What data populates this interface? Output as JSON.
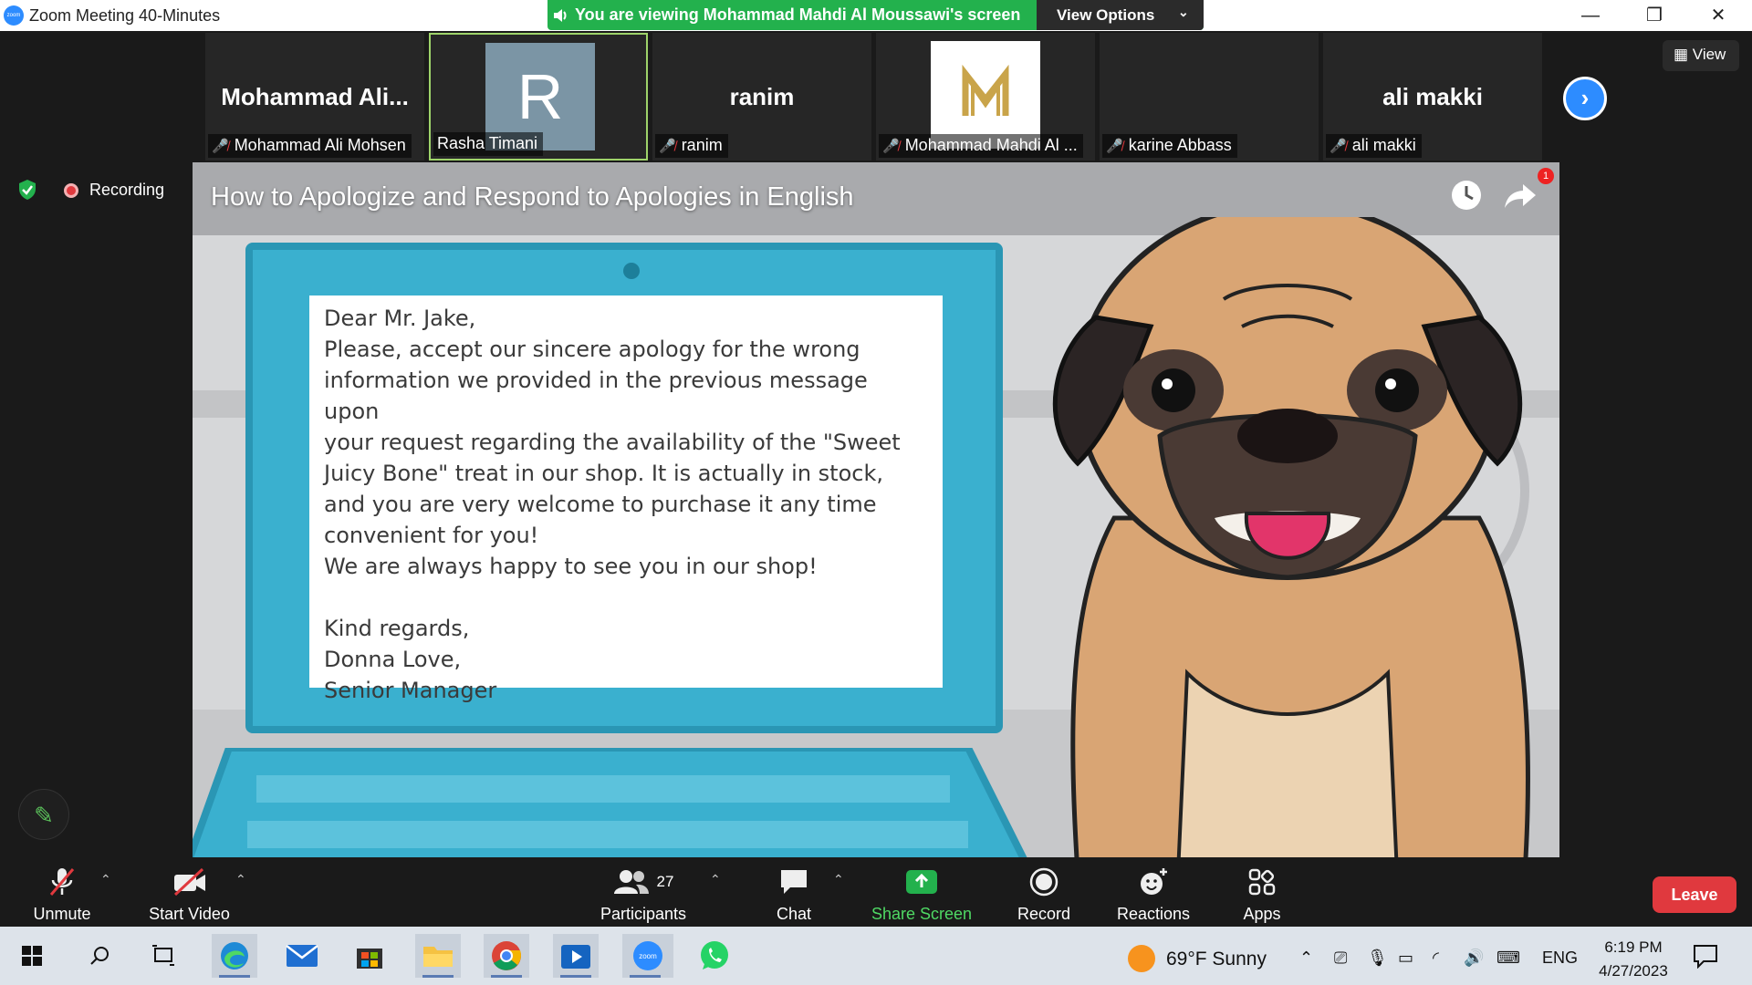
{
  "window": {
    "title": "Zoom Meeting 40-Minutes",
    "logo_text": "zoom"
  },
  "banner": {
    "text": "You are viewing Mohammad Mahdi Al Moussawi's screen",
    "view_options": "View Options"
  },
  "participants_strip": [
    {
      "big_name": "Mohammad  Ali...",
      "tag": "Mohammad Ali Mohsen",
      "muted": true
    },
    {
      "avatar_letter": "R",
      "tag": "Rasha Timani",
      "muted": false,
      "active": true
    },
    {
      "big_name": "ranim",
      "tag": "ranim",
      "muted": true
    },
    {
      "avatar_logo": "M",
      "tag": "Mohammad Mahdi Al ...",
      "muted": true
    },
    {
      "big_name": "",
      "tag": "karine Abbass",
      "muted": true
    },
    {
      "big_name": "ali makki",
      "tag": "ali makki",
      "muted": true
    }
  ],
  "view_button": "View",
  "recording": {
    "label": "Recording"
  },
  "video": {
    "title": "How to Apologize and Respond to Apologies in English",
    "notification_count": "1",
    "letter": {
      "greeting": "Dear Mr. Jake,",
      "body": "Please, accept our sincere apology for the wrong\ninformation we provided in the previous message upon\nyour request regarding the availability of the \"Sweet\nJuicy Bone\" treat in our shop. It is actually in stock,\nand you are very welcome to purchase it any time\nconvenient for you!\nWe are always happy to see you in our shop!",
      "closing": "Kind regards,\nDonna Love,\nSenior Manager"
    }
  },
  "toolbar": {
    "unmute": "Unmute",
    "start_video": "Start Video",
    "participants": "Participants",
    "participants_count": "27",
    "chat": "Chat",
    "share_screen": "Share Screen",
    "record": "Record",
    "reactions": "Reactions",
    "apps": "Apps",
    "leave": "Leave"
  },
  "taskbar": {
    "weather": "69°F  Sunny",
    "language": "ENG",
    "time": "6:19 PM",
    "date": "4/27/2023"
  },
  "colors": {
    "zoom_blue": "#2d8cff",
    "banner_green": "#23b14d",
    "leave_red": "#e0393e"
  }
}
